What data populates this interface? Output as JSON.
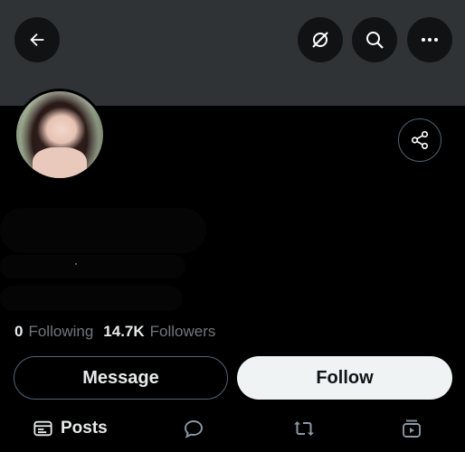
{
  "header": {
    "back_icon": "arrow-left-icon",
    "actions": [
      "hide-icon",
      "search-icon",
      "more-icon"
    ]
  },
  "profile": {
    "avatar": "profile-photo",
    "share_icon": "share-icon"
  },
  "stats": {
    "following_count": "0",
    "following_label": "Following",
    "followers_count": "14.7K",
    "followers_label": "Followers"
  },
  "actions": {
    "message_label": "Message",
    "follow_label": "Follow"
  },
  "tabs": {
    "posts_label": "Posts",
    "icons": [
      "posts-icon",
      "replies-icon",
      "reposts-icon",
      "media-icon"
    ]
  },
  "colors": {
    "banner": "#303336",
    "background": "#000000",
    "muted_text": "#71767b",
    "follow_bg": "#eff3f4"
  }
}
